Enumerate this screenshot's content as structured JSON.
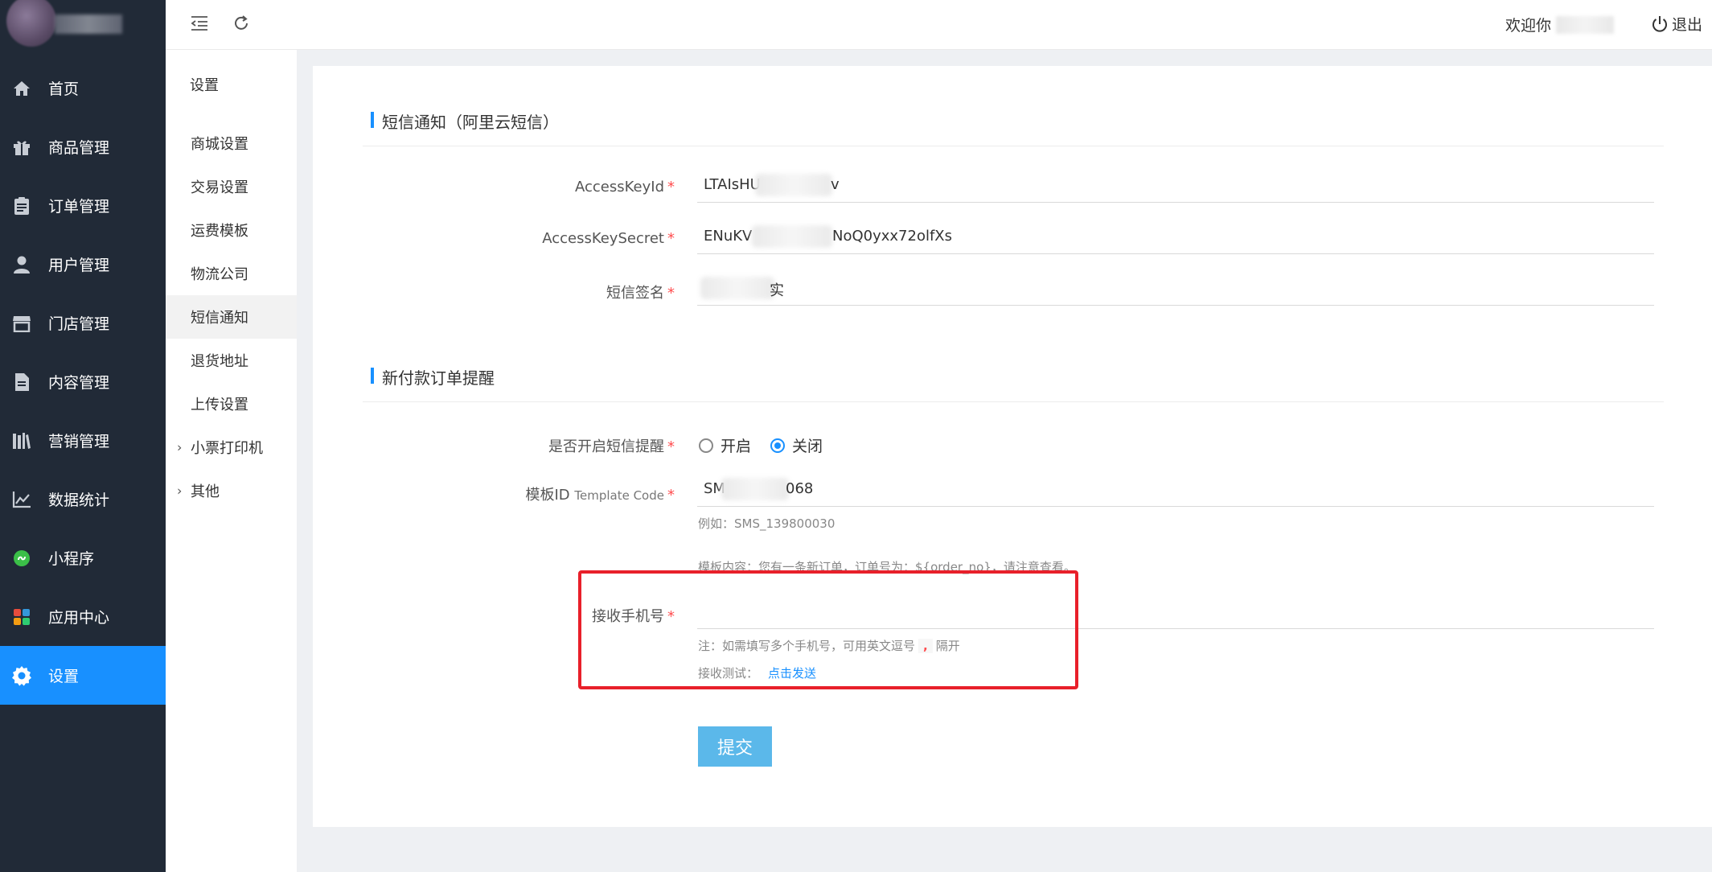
{
  "topbar": {
    "welcome_label": "欢迎你",
    "logout_label": "退出"
  },
  "sidebar": {
    "items": [
      {
        "label": "首页",
        "icon": "home-icon"
      },
      {
        "label": "商品管理",
        "icon": "gift-icon"
      },
      {
        "label": "订单管理",
        "icon": "clipboard-icon"
      },
      {
        "label": "用户管理",
        "icon": "user-icon"
      },
      {
        "label": "门店管理",
        "icon": "store-icon"
      },
      {
        "label": "内容管理",
        "icon": "document-icon"
      },
      {
        "label": "营销管理",
        "icon": "books-icon"
      },
      {
        "label": "数据统计",
        "icon": "chart-icon"
      },
      {
        "label": "小程序",
        "icon": "miniprogram-icon"
      },
      {
        "label": "应用中心",
        "icon": "apps-icon"
      },
      {
        "label": "设置",
        "icon": "gear-icon"
      }
    ],
    "active_index": 10,
    "colors": {
      "background": "#212a37",
      "active": "#1890ff"
    }
  },
  "subnav": {
    "title": "设置",
    "items": [
      {
        "label": "商城设置"
      },
      {
        "label": "交易设置"
      },
      {
        "label": "运费模板"
      },
      {
        "label": "物流公司"
      },
      {
        "label": "短信通知"
      },
      {
        "label": "退货地址"
      },
      {
        "label": "上传设置"
      },
      {
        "label": "小票打印机"
      },
      {
        "label": "其他"
      }
    ],
    "active_index": 4
  },
  "sms_section": {
    "title": "短信通知（阿里云短信）",
    "access_key_id": {
      "label": "AccessKeyId",
      "value": "LTAIsHU",
      "value_tail": "v"
    },
    "access_key_secret": {
      "label": "AccessKeySecret",
      "value": "ENuKV",
      "value_tail": "NoQ0yxx72olfXs"
    },
    "sign_name": {
      "label": "短信签名",
      "value_tail": "实"
    }
  },
  "order_section": {
    "title": "新付款订单提醒",
    "enable": {
      "label": "是否开启短信提醒",
      "options": [
        "开启",
        "关闭"
      ],
      "selected": "关闭"
    },
    "template": {
      "label": "模板ID",
      "label_sub": "Template Code",
      "value": "SM",
      "value_tail": "068",
      "example": "例如：SMS_139800030",
      "content_hint": "模板内容：您有一条新订单，订单号为：${order_no}，请注意查看。"
    },
    "phone": {
      "label": "接收手机号",
      "value": "",
      "note_before": "注：如需填写多个手机号，可用英文逗号",
      "note_comma": ",",
      "note_after": "隔开",
      "test_label": "接收测试：",
      "test_link": "点击发送"
    }
  },
  "submit_label": "提交",
  "required_mark": "*",
  "accent_color": "#1890ff",
  "highlight_color": "#e8202a"
}
